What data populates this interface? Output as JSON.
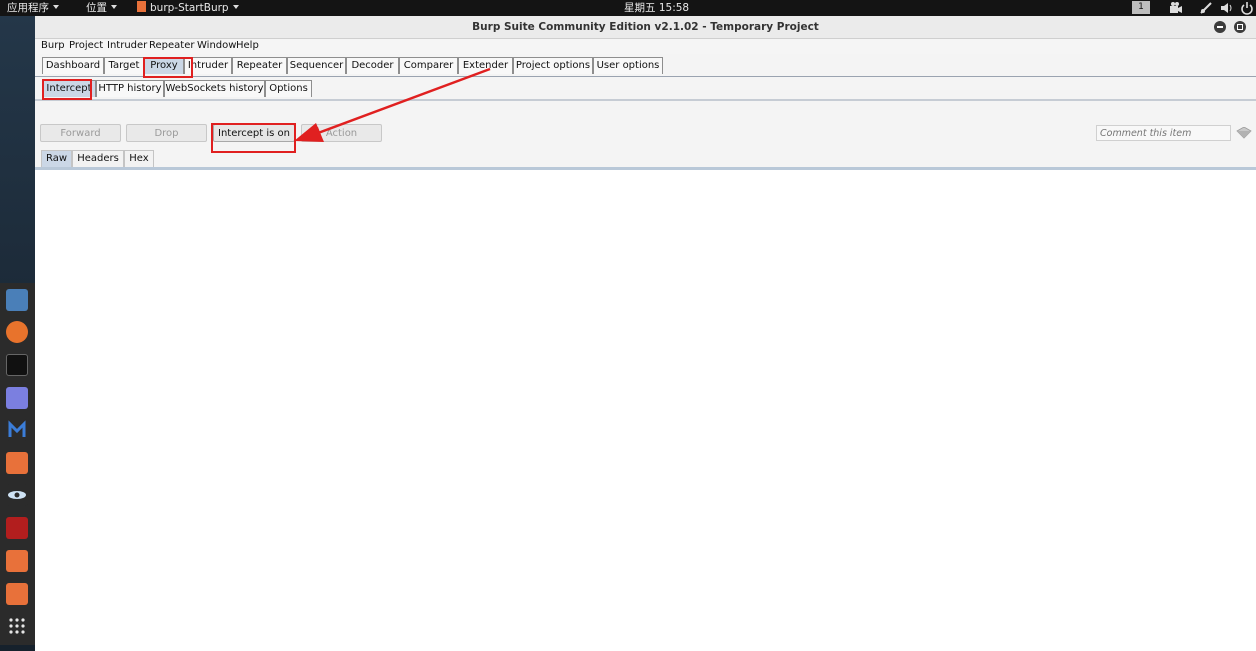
{
  "top_panel": {
    "apps_menu": "应用程序",
    "places_menu": "位置",
    "active_app": "burp-StartBurp",
    "clock": "星期五 15:58",
    "workspace": "1"
  },
  "window": {
    "title": "Burp Suite Community Edition v2.1.02 - Temporary Project"
  },
  "menu": [
    "Burp",
    "Project",
    "Intruder",
    "Repeater",
    "Window",
    "Help"
  ],
  "main_tabs": [
    "Dashboard",
    "Target",
    "Proxy",
    "Intruder",
    "Repeater",
    "Sequencer",
    "Decoder",
    "Comparer",
    "Extender",
    "Project options",
    "User options"
  ],
  "main_tabs_active": "Proxy",
  "proxy_tabs": [
    "Intercept",
    "HTTP history",
    "WebSockets history",
    "Options"
  ],
  "proxy_tabs_active": "Intercept",
  "intercept": {
    "forward": "Forward",
    "drop": "Drop",
    "toggle": "Intercept is on",
    "action": "Action",
    "comment_placeholder": "Comment this item"
  },
  "view_tabs": [
    "Raw",
    "Headers",
    "Hex"
  ],
  "view_tabs_active": "Raw",
  "dock_icons": [
    "files-icon",
    "firefox-icon",
    "terminal-icon",
    "text-editor-icon",
    "metasploit-icon",
    "burp-icon",
    "eye-icon",
    "cherrytree-icon",
    "burp-icon",
    "burp-icon",
    "app-grid-icon"
  ],
  "annotation_color": "#e02020"
}
